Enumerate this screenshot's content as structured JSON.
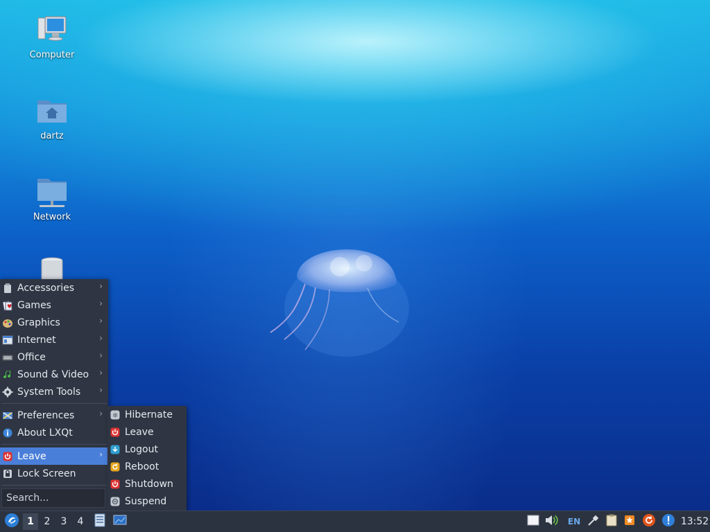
{
  "desktop": {
    "icons": [
      {
        "label": "Computer"
      },
      {
        "label": "dartz"
      },
      {
        "label": "Network"
      },
      {
        "label": "Trash"
      }
    ]
  },
  "menu": {
    "items": [
      {
        "label": "Accessories",
        "icon": "accessories-icon",
        "submenu": true
      },
      {
        "label": "Games",
        "icon": "games-icon",
        "submenu": true
      },
      {
        "label": "Graphics",
        "icon": "graphics-icon",
        "submenu": true
      },
      {
        "label": "Internet",
        "icon": "internet-icon",
        "submenu": true
      },
      {
        "label": "Office",
        "icon": "office-icon",
        "submenu": true
      },
      {
        "label": "Sound & Video",
        "icon": "sound-video-icon",
        "submenu": true
      },
      {
        "label": "System Tools",
        "icon": "gear-icon",
        "submenu": true
      },
      {
        "label": "Preferences",
        "icon": "preferences-icon",
        "submenu": true
      },
      {
        "label": "About LXQt",
        "icon": "info-icon",
        "submenu": false
      },
      {
        "label": "Leave",
        "icon": "power-icon",
        "submenu": true,
        "highlighted": true
      },
      {
        "label": "Lock Screen",
        "icon": "lock-icon",
        "submenu": false
      }
    ],
    "search_placeholder": "Search...",
    "highlight_color": "#4a7fd9"
  },
  "leave_submenu": {
    "items": [
      {
        "label": "Hibernate",
        "icon": "hibernate-icon"
      },
      {
        "label": "Leave",
        "icon": "power-icon"
      },
      {
        "label": "Logout",
        "icon": "logout-icon"
      },
      {
        "label": "Reboot",
        "icon": "reboot-icon"
      },
      {
        "label": "Shutdown",
        "icon": "shutdown-icon"
      },
      {
        "label": "Suspend",
        "icon": "suspend-icon"
      }
    ]
  },
  "taskbar": {
    "desktops": [
      "1",
      "2",
      "3",
      "4"
    ],
    "active_desktop": "1",
    "keyboard_layout": "EN",
    "clock": "13:52"
  }
}
